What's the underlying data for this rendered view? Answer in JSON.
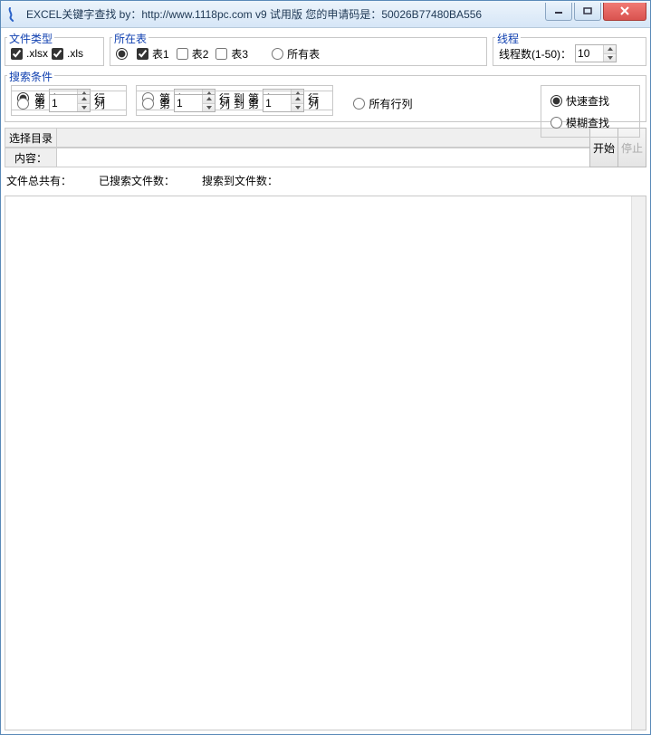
{
  "title": "EXCEL关键字查找  by：http://www.1118pc.com v9 试用版 您的申请码是：50026B77480BA556",
  "groups": {
    "filetype": {
      "legend": "文件类型",
      "xlsx": ".xlsx",
      "xls": ".xls"
    },
    "sheets": {
      "legend": "所在表",
      "s1": "表1",
      "s2": "表2",
      "s3": "表3",
      "all": "所有表"
    },
    "threads": {
      "legend": "线程",
      "label": "线程数(1-50)：",
      "value": "10"
    },
    "search": {
      "legend": "搜索条件",
      "pre": "第",
      "rowSuffix": "行",
      "colSuffix": "列",
      "to": "到",
      "r1": "1",
      "r2a": "1",
      "r2b": "1",
      "c1": "1",
      "c2a": "1",
      "c2b": "1",
      "allRC": "所有行列",
      "modeFast": "快速查找",
      "modeFuzzy": "模糊查找"
    }
  },
  "dir": {
    "button": "选择目录",
    "value": ""
  },
  "content": {
    "label": "内容：",
    "value": ""
  },
  "buttons": {
    "start": "开始",
    "stop": "停止"
  },
  "stats": {
    "total": "文件总共有：",
    "searched": "已搜索文件数：",
    "found": "搜索到文件数："
  }
}
